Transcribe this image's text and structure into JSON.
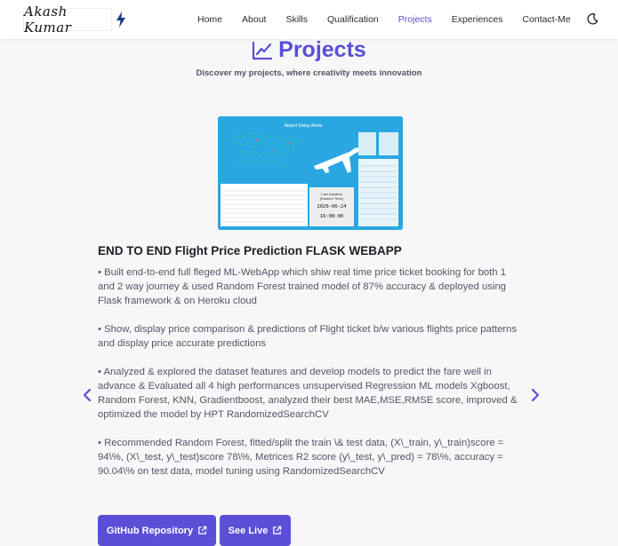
{
  "header": {
    "logo_text": "Akash Kumar",
    "nav": [
      {
        "label": "Home",
        "active": false
      },
      {
        "label": "About",
        "active": false
      },
      {
        "label": "Skills",
        "active": false
      },
      {
        "label": "Qualification",
        "active": false
      },
      {
        "label": "Projects",
        "active": true
      },
      {
        "label": "Experiences",
        "active": false
      },
      {
        "label": "Contact-Me",
        "active": false
      }
    ],
    "theme_icon": "moon-icon"
  },
  "section": {
    "title": "Projects",
    "title_icon": "line-chart-icon",
    "subtitle": "Discover my projects, where creativity meets innovation"
  },
  "project": {
    "image_title": "Airport Delay Alerts",
    "image_panel": {
      "line1": "Last Updated",
      "line2": "(Eastern Time)",
      "date": "2020-06-24",
      "time": "16:08:00"
    },
    "title": "END TO END Flight Price Prediction FLASK WEBAPP",
    "paragraphs": [
      "• Built end-to-end full fleged ML-WebApp which shiw real time price ticket booking for both 1 and 2 way journey & used Random Forest trained model of 87% accuracy & deployed using Flask framework & on Heroku cloud",
      "• Show, display price comparison & predictions of Flight ticket b/w various flights price patterns and display price accurate predictions",
      "• Analyzed & explored the dataset features and develop models to predict the fare well in advance & Evaluated all 4 high performances unsupervised Regression ML models Xgboost, Random Forest, KNN, Gradientboost, analyzed their best MAE,MSE,RMSE score, improved & optimized the model by HPT RandomizedSearchCV",
      "• Recommended Random Forest, fitted/split the train \\& test data, (X\\_train, y\\_train)score = 94\\%, (X\\_test, y\\_test)score 78\\%, Metrices R2 score (y\\_test, y\\_pred) = 78\\%, accuracy = 90.04\\% on test data, model tuning using RandomizedSearchCV"
    ],
    "buttons": {
      "github": "GitHub Repository",
      "live": "See Live"
    }
  },
  "colors": {
    "accent": "#5a4fd6",
    "image_bg": "#2aa7e1"
  }
}
